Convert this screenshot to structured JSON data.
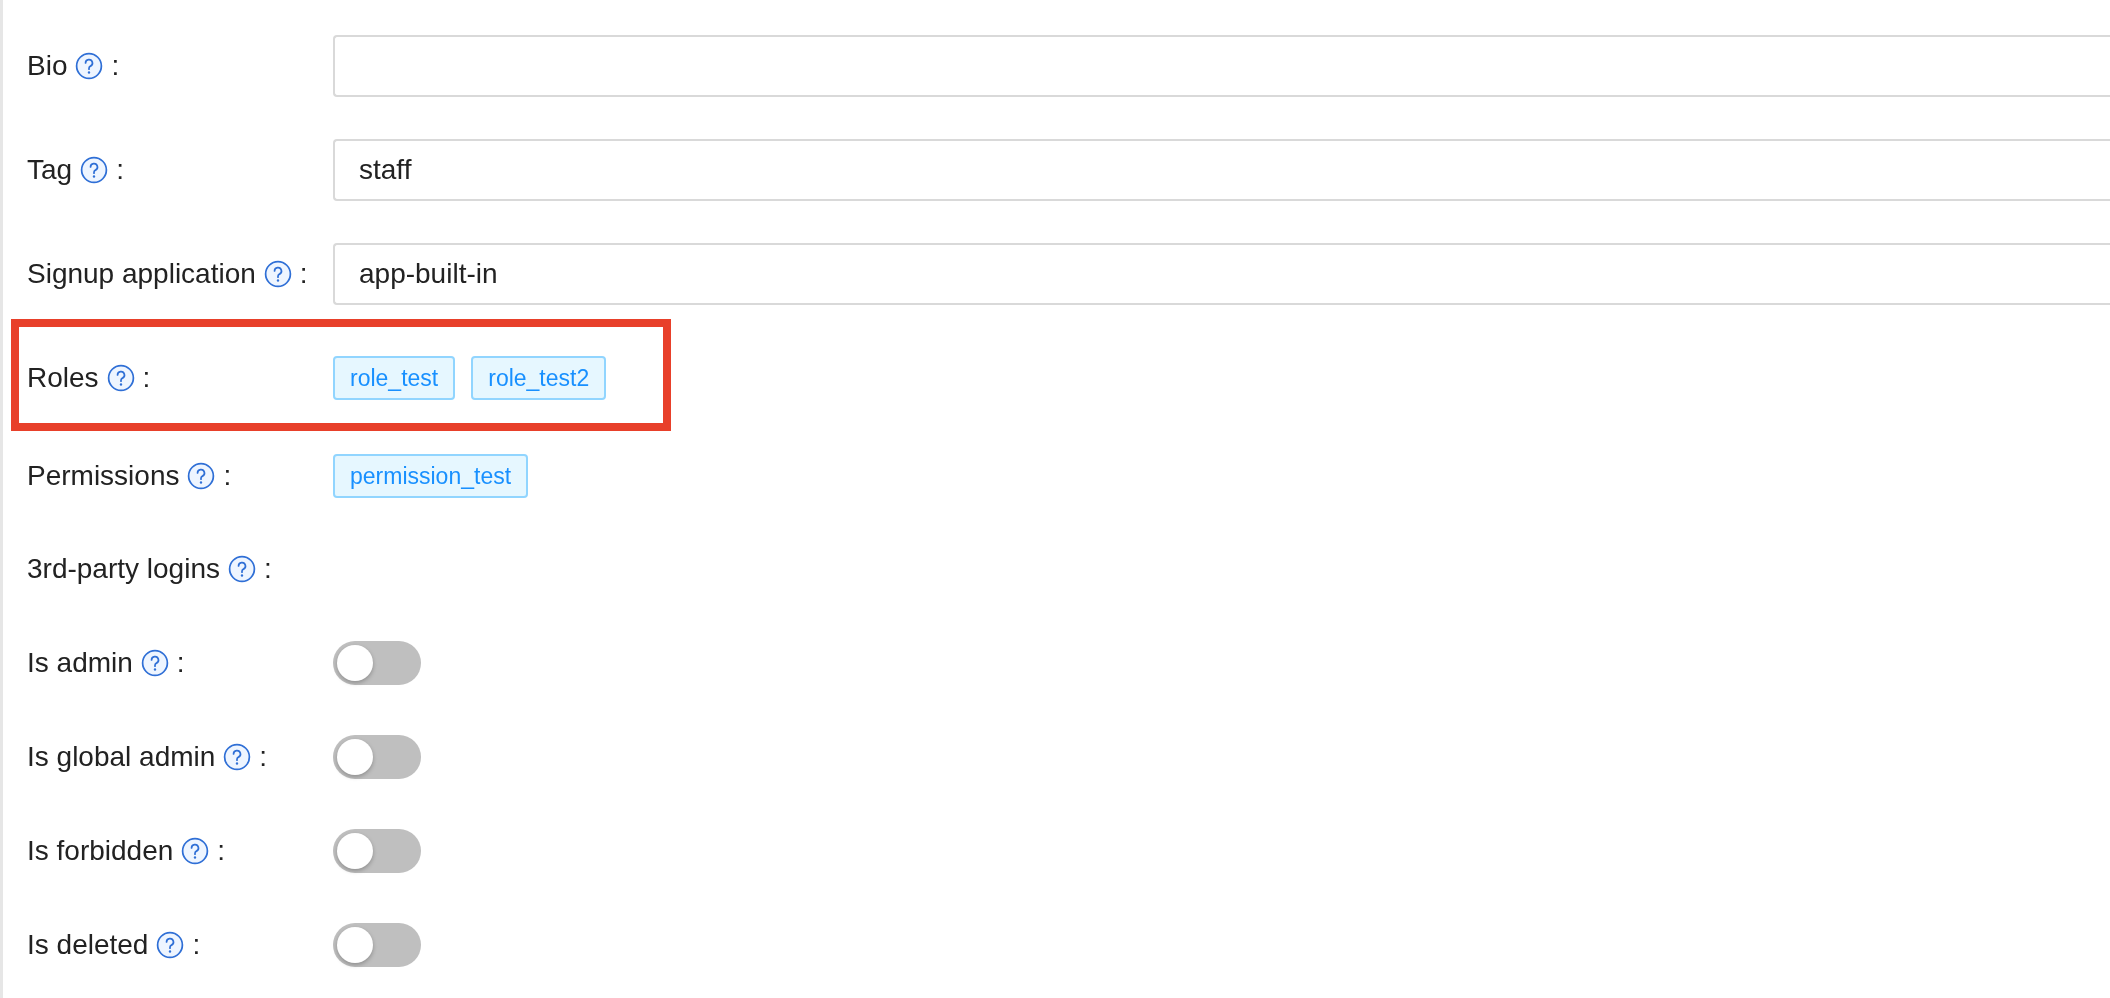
{
  "form": {
    "rows": [
      {
        "label": "Bio",
        "separator": ":",
        "kind": "input"
      },
      {
        "label": "Tag",
        "separator": ":",
        "kind": "input",
        "value": "staff"
      },
      {
        "label": "Signup application",
        "separator": ":",
        "kind": "input",
        "value": "app-built-in"
      },
      {
        "label": "Roles",
        "separator": ":",
        "kind": "tags",
        "highlighted": true,
        "tags": [
          "role_test",
          "role_test2"
        ]
      },
      {
        "label": "Permissions",
        "separator": ":",
        "kind": "tags",
        "highlighted": false,
        "tags": [
          "permission_test"
        ]
      },
      {
        "label": "3rd-party logins",
        "separator": ":",
        "kind": "empty"
      },
      {
        "label": "Is admin",
        "separator": ":",
        "kind": "switch",
        "on": false
      },
      {
        "label": "Is global admin",
        "separator": ":",
        "kind": "switch",
        "on": false
      },
      {
        "label": "Is forbidden",
        "separator": ":",
        "kind": "switch",
        "on": false
      },
      {
        "label": "Is deleted",
        "separator": ":",
        "kind": "switch",
        "on": false
      }
    ]
  }
}
